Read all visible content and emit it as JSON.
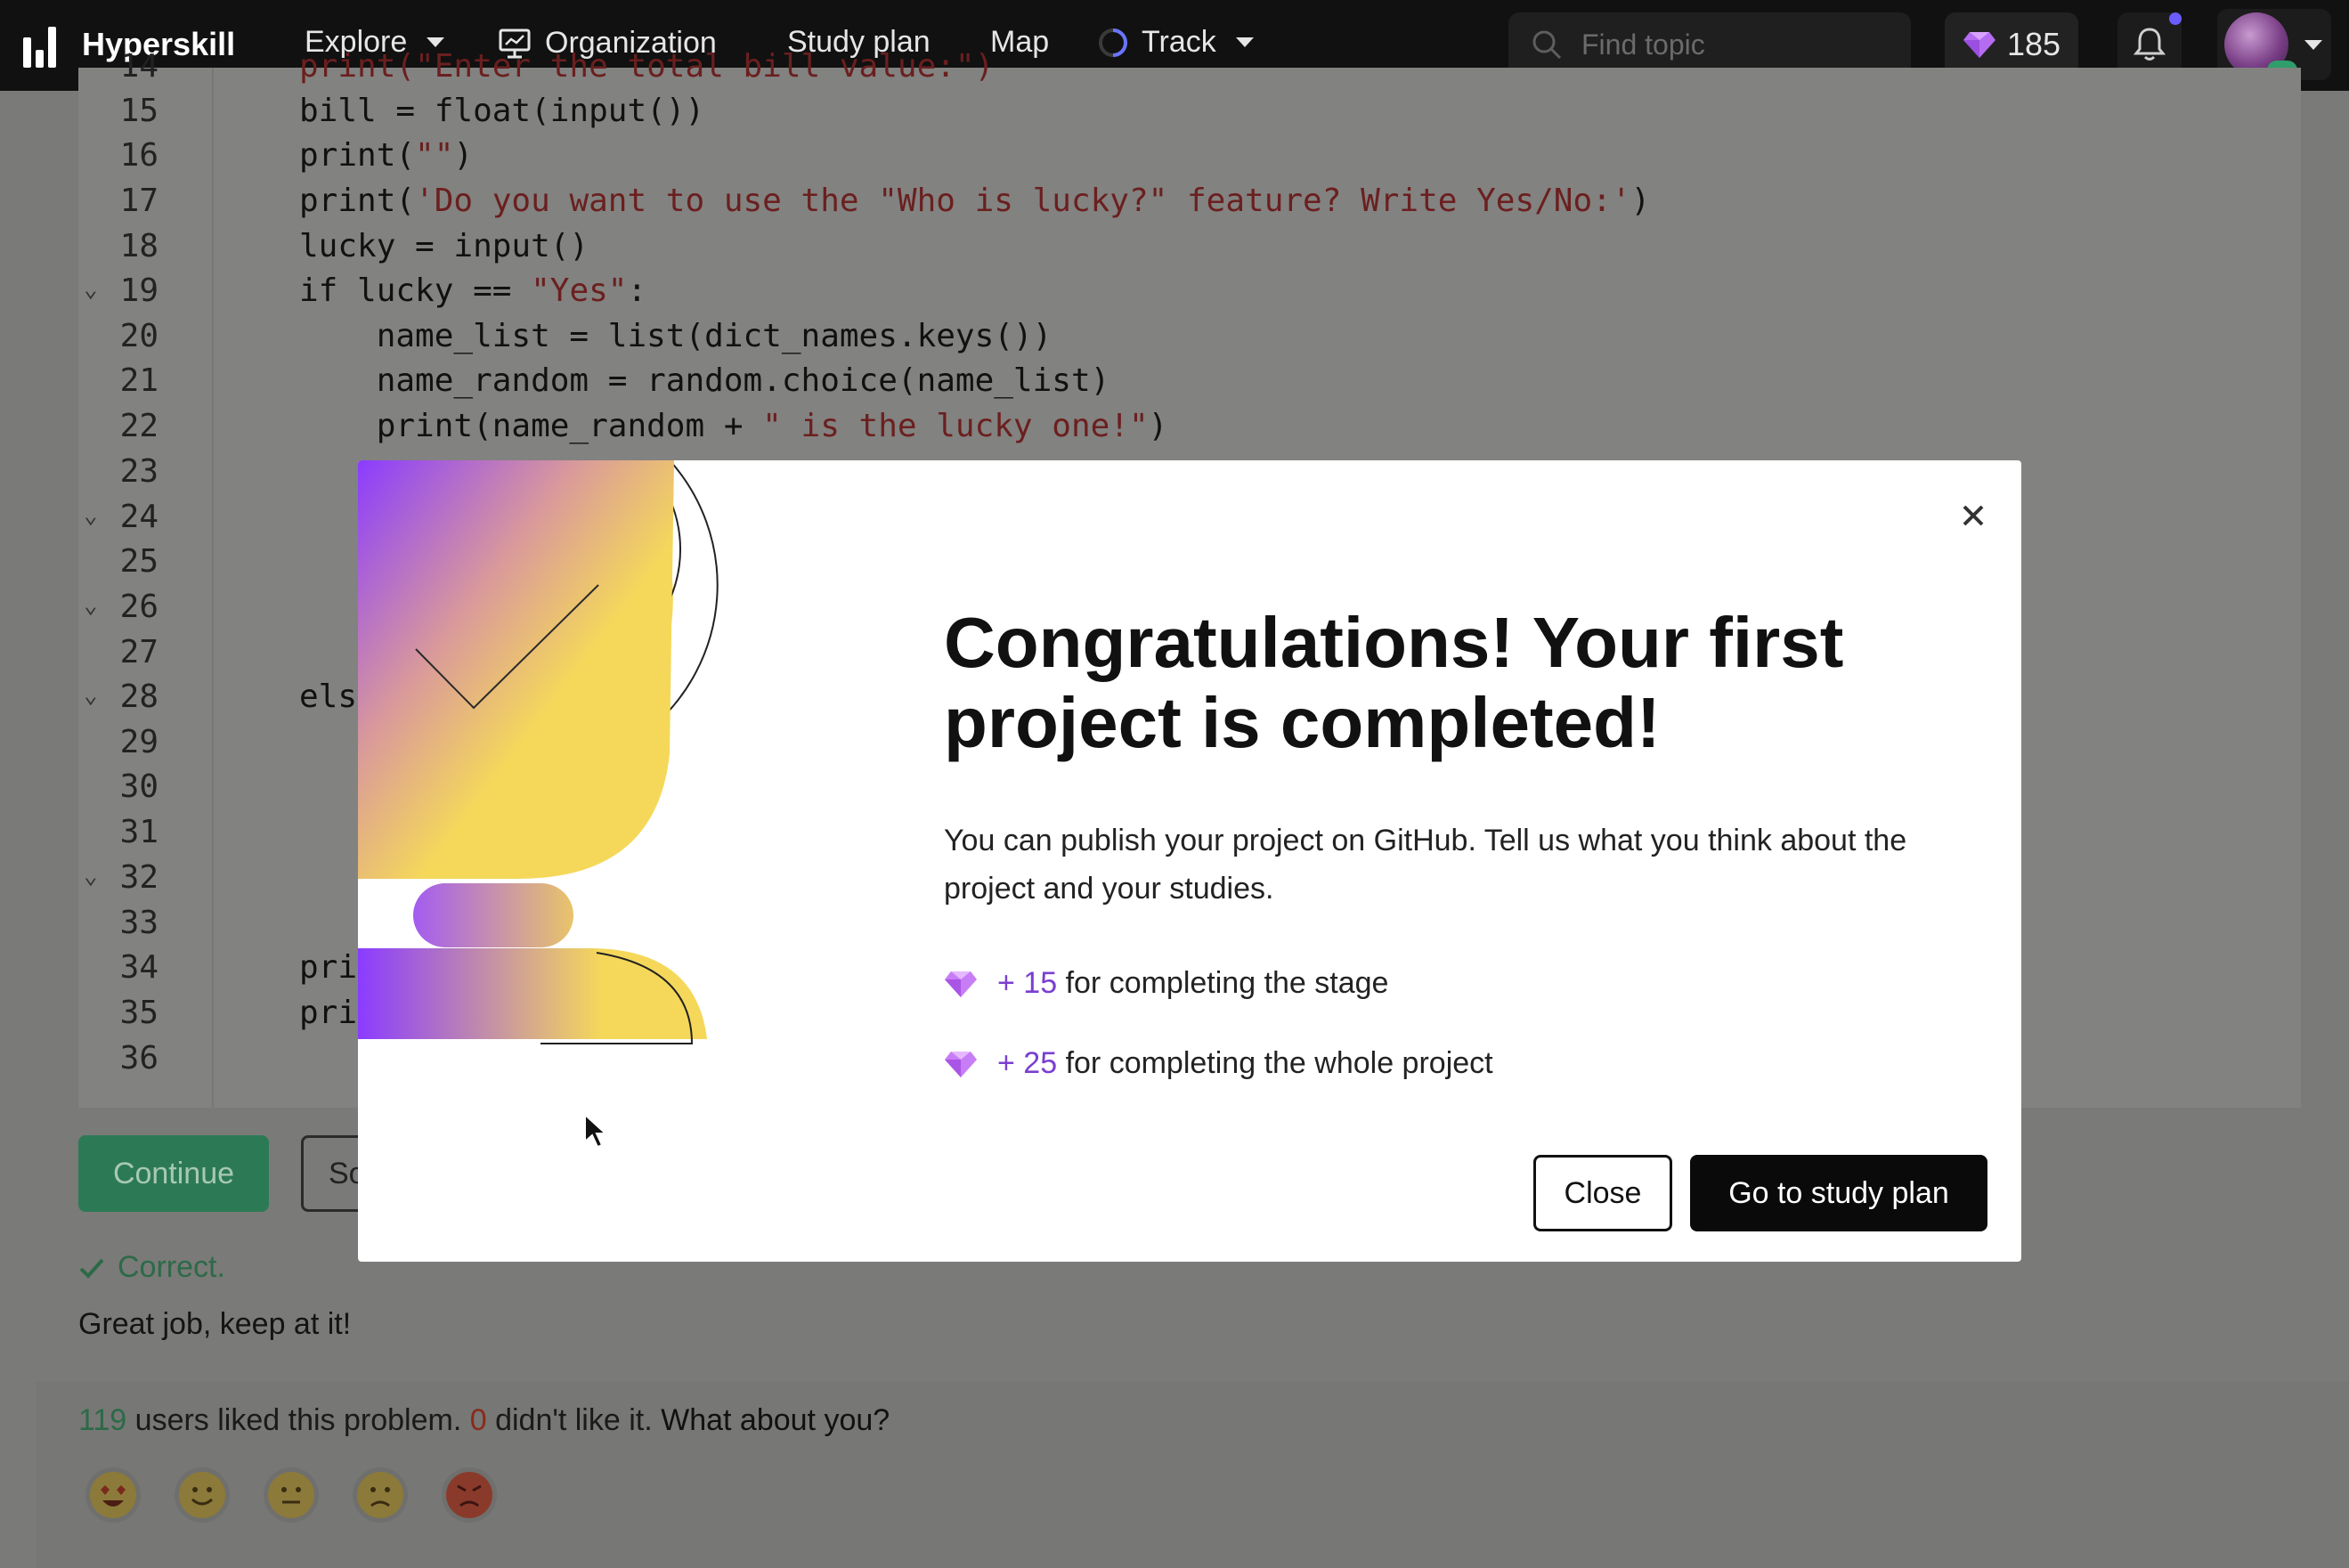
{
  "nav": {
    "brand": "Hyperskill",
    "items": [
      {
        "label": "Explore",
        "has_caret": true
      },
      {
        "label": "Organization",
        "has_caret": false
      },
      {
        "label": "Study plan",
        "has_caret": false
      },
      {
        "label": "Map",
        "has_caret": false
      },
      {
        "label": "Track",
        "has_caret": true
      }
    ],
    "search_placeholder": "Find topic",
    "gems": "185"
  },
  "editor": {
    "lines": [
      {
        "n": "14",
        "code": "print(\"Enter the total bill value:\")"
      },
      {
        "n": "15",
        "code": "bill = float(input())"
      },
      {
        "n": "16",
        "code": "print(\"\")"
      },
      {
        "n": "17",
        "code": "print('Do you want to use the \"Who is lucky?\" feature? Write Yes/No:')"
      },
      {
        "n": "18",
        "code": "lucky = input()"
      },
      {
        "n": "19",
        "code": "if lucky == \"Yes\":"
      },
      {
        "n": "20",
        "code": "    name_list = list(dict_names.keys())"
      },
      {
        "n": "21",
        "code": "    name_random = random.choice(name_list)"
      },
      {
        "n": "22",
        "code": "    print(name_random + \" is the lucky one!\")"
      },
      {
        "n": "23",
        "code": ""
      },
      {
        "n": "24",
        "code": ""
      },
      {
        "n": "25",
        "code": ""
      },
      {
        "n": "26",
        "code": ""
      },
      {
        "n": "27",
        "code": ""
      },
      {
        "n": "28",
        "code": "els"
      },
      {
        "n": "29",
        "code": ""
      },
      {
        "n": "30",
        "code": ""
      },
      {
        "n": "31",
        "code": ""
      },
      {
        "n": "32",
        "code": ""
      },
      {
        "n": "33",
        "code": ""
      },
      {
        "n": "34",
        "code": "pri"
      },
      {
        "n": "35",
        "code": "pri"
      },
      {
        "n": "36",
        "code": ""
      }
    ]
  },
  "actions": {
    "continue_label": "Continue",
    "solve_label": "So"
  },
  "feedback": {
    "correct": "Correct.",
    "message": "Great job, keep at it!"
  },
  "likes": {
    "liked_count": "119",
    "liked_text": " users liked this problem. ",
    "disliked_count": "0",
    "disliked_text": " didn't like it. ",
    "question": "What about you?"
  },
  "modal": {
    "title": "Congratulations! Your first project is completed!",
    "description": "You can publish your project on GitHub. Tell us what you think about the project and your studies.",
    "rewards": [
      {
        "points": "+ 15",
        "text": " for completing the stage"
      },
      {
        "points": "+ 25",
        "text": " for completing the whole project"
      }
    ],
    "close_label": "Close",
    "primary_label": "Go to study plan"
  },
  "colors": {
    "accent_green": "#2c7a55",
    "gem_purple": "#b56cf0",
    "trophy_yellow": "#f5d85a",
    "trophy_purple": "#8a3cff"
  }
}
